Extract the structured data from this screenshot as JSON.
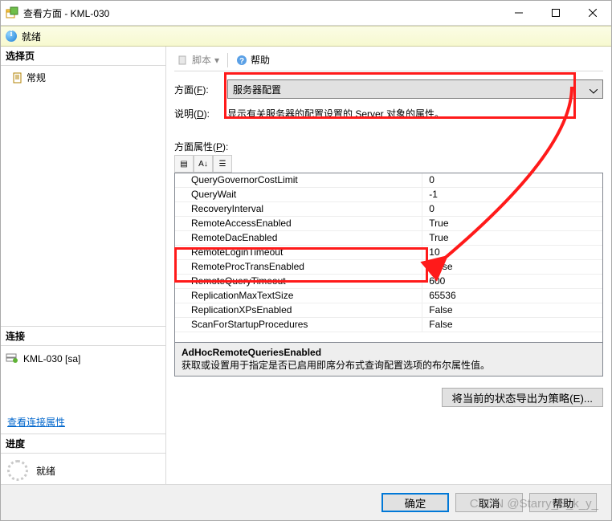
{
  "window": {
    "title": "查看方面 - KML-030"
  },
  "status": {
    "text": "就绪"
  },
  "left": {
    "select_header": "选择页",
    "tree": {
      "general": "常规"
    },
    "conn_header": "连接",
    "server": "KML-030 [sa]",
    "view_conn_props": "查看连接属性",
    "progress_header": "进度",
    "progress_text": "就绪"
  },
  "toolbar": {
    "script": "脚本",
    "help": "帮助"
  },
  "form": {
    "facet_label_pre": "方面(",
    "facet_label_u": "F",
    "facet_label_post": "):",
    "facet_value": "服务器配置",
    "desc_label_pre": "说明(",
    "desc_label_u": "D",
    "desc_label_post": "):",
    "desc_value": "显示有关服务器的配置设置的 Server 对象的属性。",
    "props_label_pre": "方面属性(",
    "props_label_u": "P",
    "props_label_post": "):"
  },
  "grid_tools": {
    "cat": "▤",
    "az": "A↓",
    "pages": "☰"
  },
  "props": [
    {
      "k": "QueryGovernorCostLimit",
      "v": "0"
    },
    {
      "k": "QueryWait",
      "v": "-1"
    },
    {
      "k": "RecoveryInterval",
      "v": "0"
    },
    {
      "k": "RemoteAccessEnabled",
      "v": "True"
    },
    {
      "k": "RemoteDacEnabled",
      "v": "True"
    },
    {
      "k": "RemoteLoginTimeout",
      "v": "10"
    },
    {
      "k": "RemoteProcTransEnabled",
      "v": "False"
    },
    {
      "k": "RemoteQueryTimeout",
      "v": "600"
    },
    {
      "k": "ReplicationMaxTextSize",
      "v": "65536"
    },
    {
      "k": "ReplicationXPsEnabled",
      "v": "False"
    },
    {
      "k": "ScanForStartupProcedures",
      "v": "False"
    }
  ],
  "prop_desc": {
    "title": "AdHocRemoteQueriesEnabled",
    "body": "获取或设置用于指定是否已启用即席分布式查询配置选项的布尔属性值。"
  },
  "buttons": {
    "export": "将当前的状态导出为策略(E)...",
    "ok": "确定",
    "cancel": "取消",
    "help": "帮助"
  },
  "watermark": "CSDN @Starry_S_k_y_"
}
